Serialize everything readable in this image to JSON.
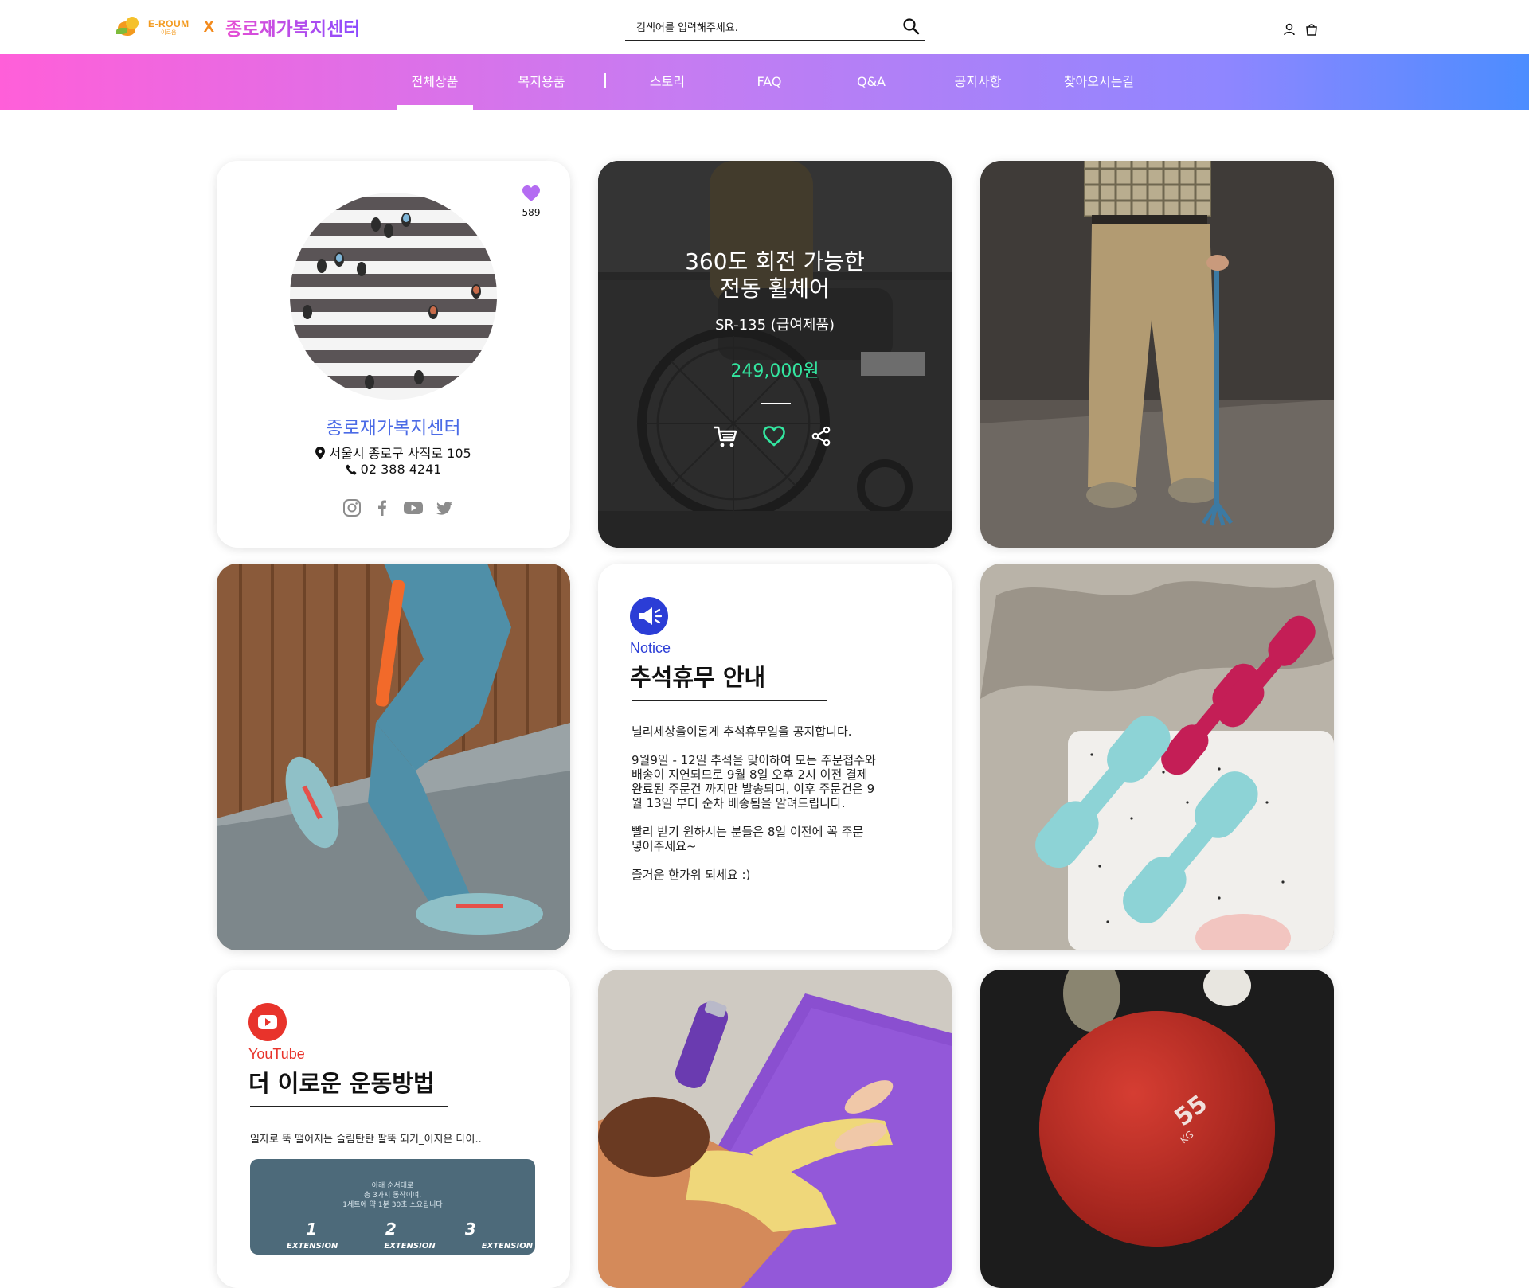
{
  "header": {
    "brand_en": "E-ROUM",
    "brand_ko": "이로움",
    "brand_x": "X",
    "brand_center": "종로재가복지센터",
    "search_placeholder": "검색어를 입력해주세요."
  },
  "nav": {
    "items": [
      "전체상품",
      "복지용품",
      "스토리",
      "FAQ",
      "Q&A",
      "공지사항",
      "찾아오시는길"
    ],
    "active": "전체상품"
  },
  "profile": {
    "likes": "589",
    "name": "종로재가복지센터",
    "address": "서울시 종로구 사직로 105",
    "phone": "02 388 4241",
    "social_icons": [
      "instagram-icon",
      "facebook-icon",
      "youtube-icon",
      "twitter-icon"
    ]
  },
  "product": {
    "title_line1": "360도 회전 가능한",
    "title_line2": "전동 휠체어",
    "model": "SR-135 (급여제품)",
    "price": "249,000원"
  },
  "notice": {
    "tag": "Notice",
    "title": "추석휴무 안내",
    "p1": "널리세상을이롭게 추석휴무일을 공지합니다.",
    "p2": "9월9일 - 12일 추석을 맞이하여 모든 주문접수와\n배송이 지연되므로 9월 8일 오후 2시 이전 결제\n완료된 주문건 까지만 발송되며, 이후 주문건은 9\n월 13일 부터 순차 배송됨을 알려드립니다.",
    "p3": "빨리 받기 원하시는 분들은 8일 이전에 꼭 주문\n넣어주세요~",
    "p4": "즐거운 한가위 되세요 :)"
  },
  "youtube": {
    "tag": "YouTube",
    "title": "더 이로운 운동방법",
    "desc": "일자로 뚝 떨어지는 슬림탄탄 팔뚝 되기_이지은 다이..",
    "thumb_text": "아래 순서대로\n총 3가지 동작이며,\n1세트에 약 1분 30초 소요됩니다",
    "thumb_numbers": [
      "1",
      "2",
      "3"
    ],
    "thumb_labels": [
      "EXTENSION",
      "EXTENSION",
      "EXTENSION"
    ]
  },
  "colors": {
    "nav_gradient_start": "#ff5fd9",
    "nav_gradient_end": "#4c8dff",
    "price": "#33e6a0",
    "profile_name": "#4b6be6",
    "heart": "#b46cf2",
    "youtube_red": "#e8332b",
    "notice_blue": "#2b3dd6"
  }
}
